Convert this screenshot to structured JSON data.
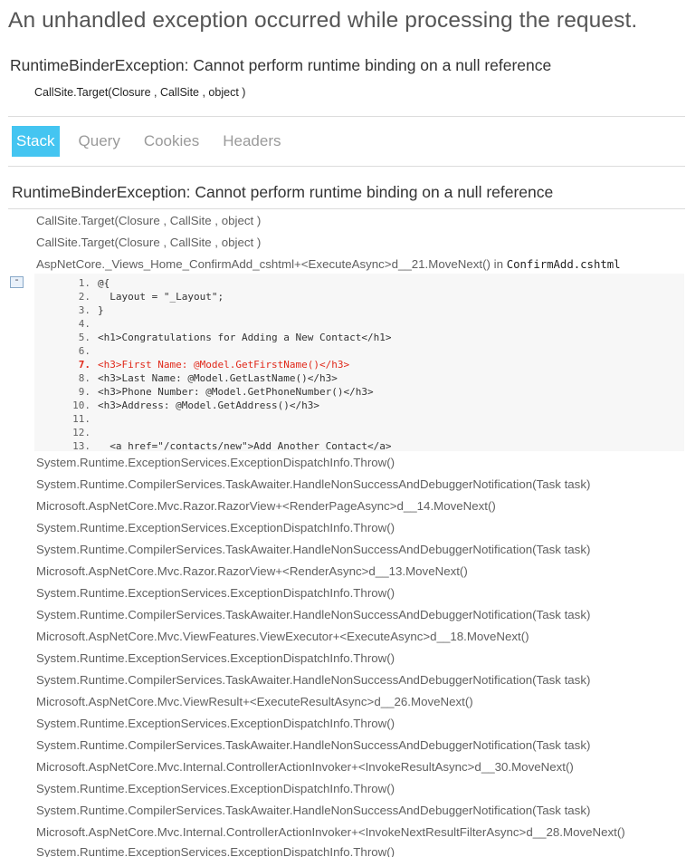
{
  "page": {
    "title": "An unhandled exception occurred while processing the request.",
    "error_message": "RuntimeBinderException: Cannot perform runtime binding on a null reference",
    "error_location": "CallSite.Target(Closure , CallSite , object )"
  },
  "tabs": [
    {
      "label": "Stack",
      "active": true
    },
    {
      "label": "Query",
      "active": false
    },
    {
      "label": "Cookies",
      "active": false
    },
    {
      "label": "Headers",
      "active": false
    }
  ],
  "stack": {
    "title": "RuntimeBinderException: Cannot perform runtime binding on a null reference",
    "frames_before": [
      "CallSite.Target(Closure , CallSite , object )",
      "CallSite.Target(Closure , CallSite , object )"
    ],
    "source_frame": {
      "method": "AspNetCore._Views_Home_ConfirmAdd_cshtml+<ExecuteAsync>d__21.MoveNext() in ",
      "file": "ConfirmAdd.cshtml",
      "expander_label": "-"
    },
    "source_lines": [
      {
        "num": "1.",
        "code": "@{",
        "error": false
      },
      {
        "num": "2.",
        "code": "  Layout = \"_Layout\";",
        "error": false
      },
      {
        "num": "3.",
        "code": "}",
        "error": false
      },
      {
        "num": "4.",
        "code": "",
        "error": false
      },
      {
        "num": "5.",
        "code": "<h1>Congratulations for Adding a New Contact</h1>",
        "error": false
      },
      {
        "num": "6.",
        "code": "",
        "error": false
      },
      {
        "num": "7.",
        "code": "<h3>First Name: @Model.GetFirstName()</h3>",
        "error": true
      },
      {
        "num": "8.",
        "code": "<h3>Last Name: @Model.GetLastName()</h3>",
        "error": false
      },
      {
        "num": "9.",
        "code": "<h3>Phone Number: @Model.GetPhoneNumber()</h3>",
        "error": false
      },
      {
        "num": "10.",
        "code": "<h3>Address: @Model.GetAddress()</h3>",
        "error": false
      },
      {
        "num": "11.",
        "code": "",
        "error": false
      },
      {
        "num": "12.",
        "code": "",
        "error": false
      },
      {
        "num": "13.",
        "code": "  <a href=\"/contacts/new\">Add Another Contact</a>",
        "error": false
      }
    ],
    "frames_after": [
      "System.Runtime.ExceptionServices.ExceptionDispatchInfo.Throw()",
      "System.Runtime.CompilerServices.TaskAwaiter.HandleNonSuccessAndDebuggerNotification(Task task)",
      "Microsoft.AspNetCore.Mvc.Razor.RazorView+<RenderPageAsync>d__14.MoveNext()",
      "System.Runtime.ExceptionServices.ExceptionDispatchInfo.Throw()",
      "System.Runtime.CompilerServices.TaskAwaiter.HandleNonSuccessAndDebuggerNotification(Task task)",
      "Microsoft.AspNetCore.Mvc.Razor.RazorView+<RenderAsync>d__13.MoveNext()",
      "System.Runtime.ExceptionServices.ExceptionDispatchInfo.Throw()",
      "System.Runtime.CompilerServices.TaskAwaiter.HandleNonSuccessAndDebuggerNotification(Task task)",
      "Microsoft.AspNetCore.Mvc.ViewFeatures.ViewExecutor+<ExecuteAsync>d__18.MoveNext()",
      "System.Runtime.ExceptionServices.ExceptionDispatchInfo.Throw()",
      "System.Runtime.CompilerServices.TaskAwaiter.HandleNonSuccessAndDebuggerNotification(Task task)",
      "Microsoft.AspNetCore.Mvc.ViewResult+<ExecuteResultAsync>d__26.MoveNext()",
      "System.Runtime.ExceptionServices.ExceptionDispatchInfo.Throw()",
      "System.Runtime.CompilerServices.TaskAwaiter.HandleNonSuccessAndDebuggerNotification(Task task)",
      "Microsoft.AspNetCore.Mvc.Internal.ControllerActionInvoker+<InvokeResultAsync>d__30.MoveNext()",
      "System.Runtime.ExceptionServices.ExceptionDispatchInfo.Throw()",
      "System.Runtime.CompilerServices.TaskAwaiter.HandleNonSuccessAndDebuggerNotification(Task task)",
      "Microsoft.AspNetCore.Mvc.Internal.ControllerActionInvoker+<InvokeNextResultFilterAsync>d__28.MoveNext()",
      "System.Runtime.ExceptionServices.ExceptionDispatchInfo.Throw()"
    ]
  }
}
